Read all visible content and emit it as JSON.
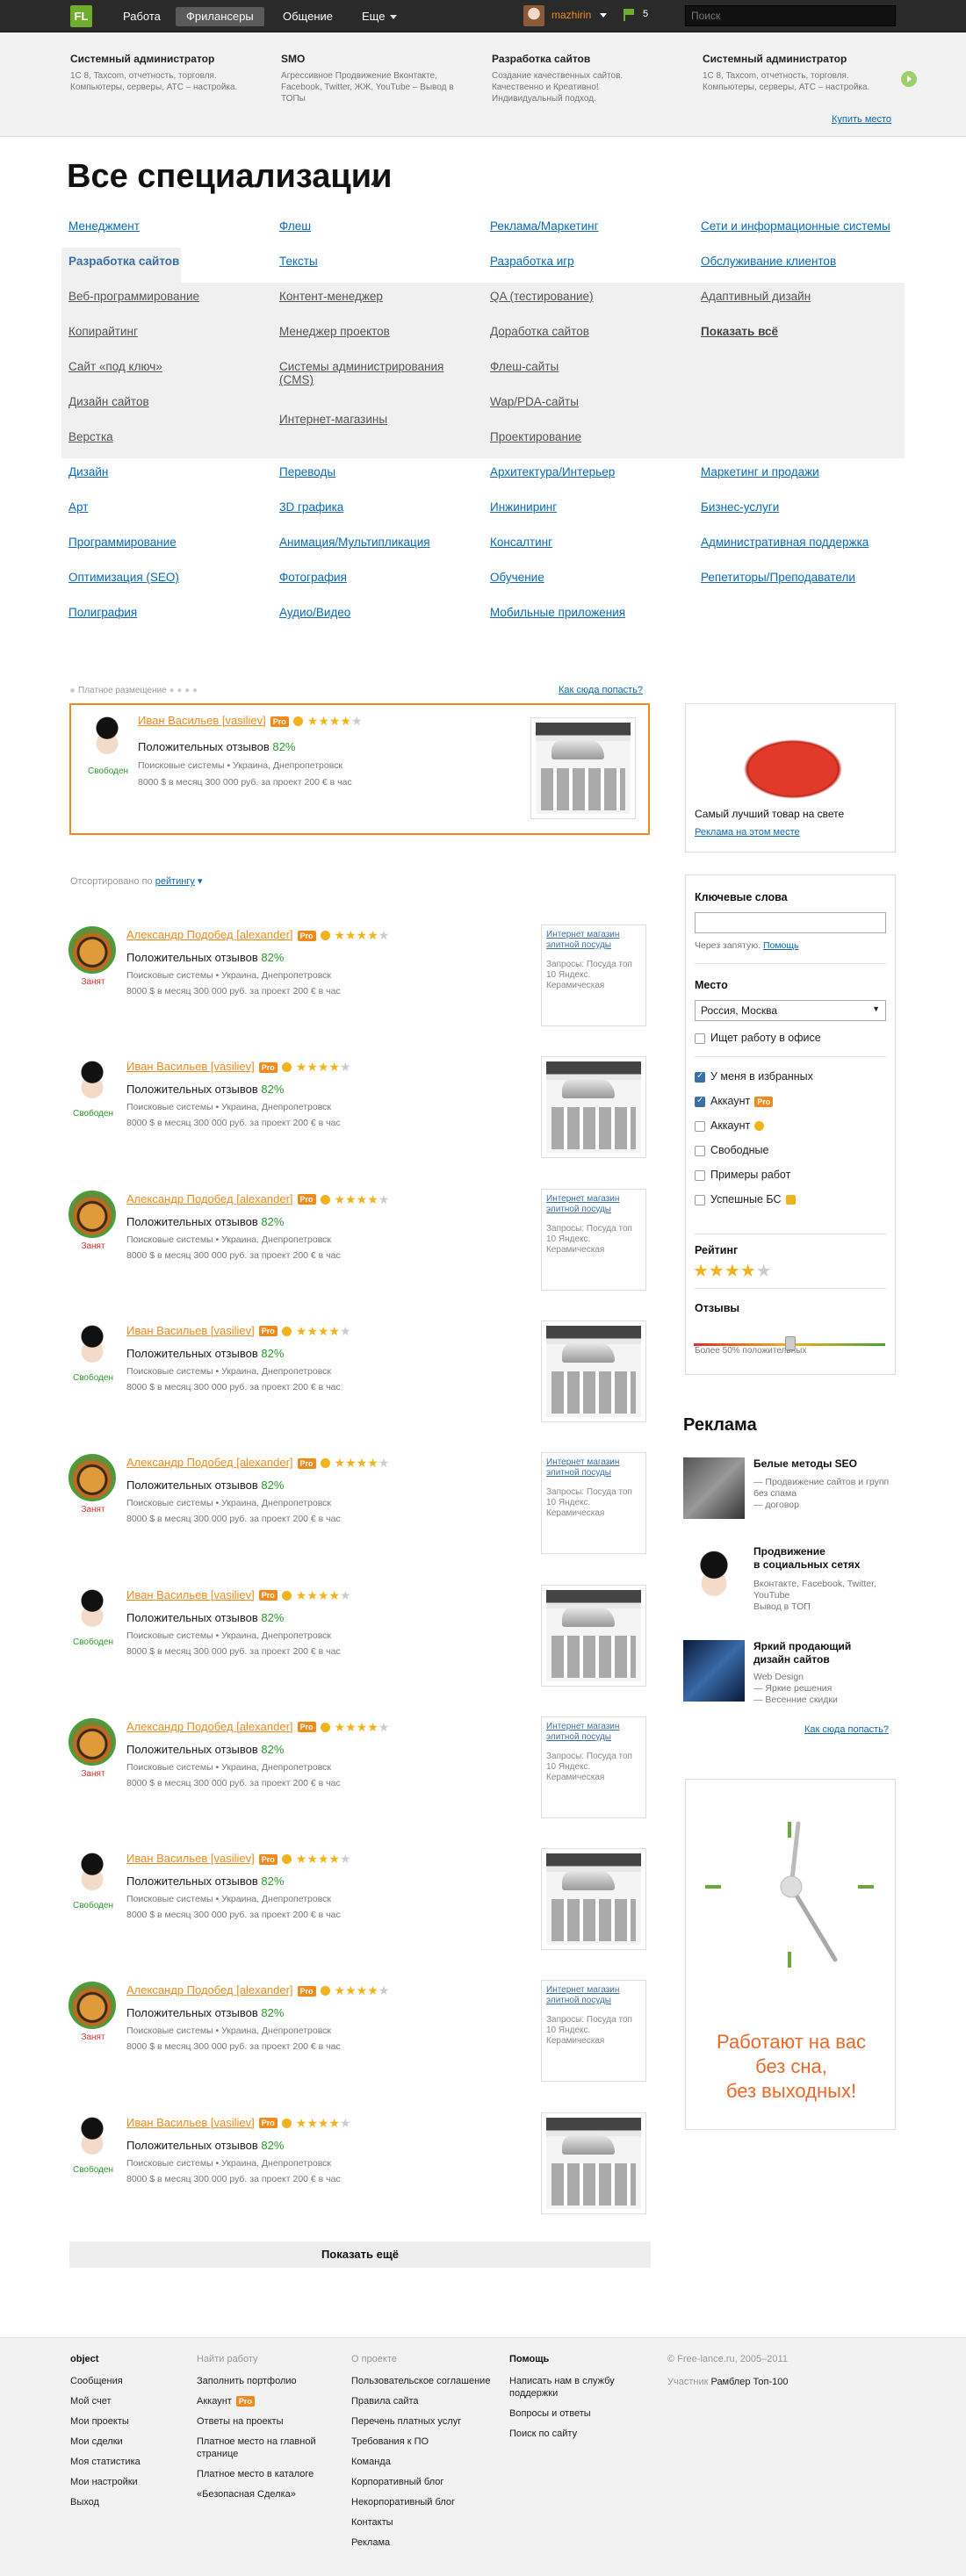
{
  "topbar": {
    "logo": "FL",
    "nav": [
      "Работа",
      "Фрилансеры",
      "Общение",
      "Еще"
    ],
    "username": "mazhirin",
    "flag_count": "5",
    "search_placeholder": "Поиск"
  },
  "strip": {
    "items": [
      {
        "title": "Системный администратор",
        "desc": "1С 8, Taxcom, отчетность, торговля. Компьютеры, серверы, АТС – настройка."
      },
      {
        "title": "SMO",
        "desc": "Агрессивное Продвижение Вконтакте, Facebook, Twitter, ЖЖ, YouTube – Вывод в ТОПы"
      },
      {
        "title": "Разработка сайтов",
        "desc": "Создание качественных сайтов. Качественно и Креативно! Индивидуальный подход."
      },
      {
        "title": "Системный администратор",
        "desc": "1С 8, Taxcom, отчетность, торговля. Компьютеры, серверы, АТС – настройка."
      }
    ],
    "buy_link": "Купить место"
  },
  "specs": {
    "title": "Все специализации",
    "col1": [
      "Менеджмент",
      "Разработка сайтов",
      "Веб-программирование",
      "Копирайтинг",
      "Сайт «под ключ»",
      "Дизайн сайтов",
      "Верстка",
      "Дизайн",
      "Арт",
      "Программирование",
      "Оптимизация (SEO)",
      "Полиграфия"
    ],
    "col2": [
      "Флеш",
      "Тексты",
      "Контент-менеджер",
      "Менеджер проектов",
      "Системы администрирования (CMS)",
      "Интернет-магазины",
      "Переводы",
      "3D графика",
      "Анимация/Мультипликация",
      "Фотография",
      "Аудио/Видео"
    ],
    "col3": [
      "Реклама/Маркетинг",
      "Разработка игр",
      "QA (тестирование)",
      "Доработка сайтов",
      "Флеш-сайты",
      "Wap/PDA-сайты",
      "Проектирование",
      "Архитектура/Интерьер",
      "Инжиниринг",
      "Консалтинг",
      "Обучение",
      "Мобильные приложения"
    ],
    "col4": [
      "Сети и информационные системы",
      "Обслуживание клиентов",
      "Адаптивный дизайн",
      "Показать всё",
      "Маркетинг и продажи",
      "Бизнес-услуги",
      "Административная поддержка",
      "Репетиторы/Преподаватели"
    ]
  },
  "paid": {
    "label": "Платное размещение",
    "how": "Как сюда попасть?",
    "freelancer": {
      "name": "Иван Васильев [vasiliev]",
      "pro": "Pro",
      "status": "Свободен",
      "reviews_label": "Положительных отзывов",
      "reviews_pct": "82%",
      "meta": "Поисковые системы  •  Украина, Днепропетровск",
      "price": "8000 $ в месяц    300 000 руб. за проект    200 € в час"
    }
  },
  "sort": {
    "prefix": "Отсортировано по",
    "link": "рейтингу"
  },
  "freelancers": [
    {
      "name": "Александр Подобед [alexander]",
      "status": "Занят",
      "type": "tiger",
      "thumb": "text"
    },
    {
      "name": "Иван Васильев [vasiliev]",
      "status": "Свободен",
      "type": "girl",
      "thumb": "shot"
    },
    {
      "name": "Александр Подобед [alexander]",
      "status": "Занят",
      "type": "tiger",
      "thumb": "text"
    },
    {
      "name": "Иван Васильев [vasiliev]",
      "status": "Свободен",
      "type": "girl",
      "thumb": "shot"
    },
    {
      "name": "Александр Подобед [alexander]",
      "status": "Занят",
      "type": "tiger",
      "thumb": "text"
    },
    {
      "name": "Иван Васильев [vasiliev]",
      "status": "Свободен",
      "type": "girl",
      "thumb": "shot"
    },
    {
      "name": "Александр Подобед [alexander]",
      "status": "Занят",
      "type": "tiger",
      "thumb": "text"
    },
    {
      "name": "Иван Васильев [vasiliev]",
      "status": "Свободен",
      "type": "girl",
      "thumb": "shot"
    },
    {
      "name": "Александр Подобед [alexander]",
      "status": "Занят",
      "type": "tiger",
      "thumb": "text"
    },
    {
      "name": "Иван Васильев [vasiliev]",
      "status": "Свободен",
      "type": "girl",
      "thumb": "shot"
    }
  ],
  "row_common": {
    "pro": "Pro",
    "reviews_label": "Положительных отзывов",
    "reviews_pct": "82%",
    "meta": "Поисковые системы  •  Украина, Днепропетровск",
    "price": "8000 $ в месяц    300 000 руб. за проект    200 € в час",
    "thumb_title": "Интернет магазин элитной посуды",
    "thumb_query": "Запросы: Посуда топ 10 Яндекс. Керамическая"
  },
  "right": {
    "promo_title": "Самый лучший товар на свете",
    "promo_link": "Реклама на этом месте",
    "keywords_title": "Ключевые слова",
    "keywords_hint": "Через запятую.",
    "keywords_help": "Помощь",
    "place_title": "Место",
    "place_value": "Россия, Москва",
    "office": "Ищет работу в офисе",
    "checks": [
      {
        "label": "У меня в избранных",
        "on": true
      },
      {
        "label": "Аккаунт",
        "on": true,
        "badge": "Pro"
      },
      {
        "label": "Аккаунт",
        "on": false,
        "badge": "ok"
      },
      {
        "label": "Свободные",
        "on": false
      },
      {
        "label": "Примеры работ",
        "on": false
      },
      {
        "label": "Успешные БС",
        "on": false
      }
    ],
    "rating_title": "Рейтинг",
    "reviews_title": "Отзывы",
    "reviews_hint": "Более 50% положительных",
    "ads_title": "Реклама",
    "ads": [
      {
        "name": "Белые методы SEO",
        "desc": "— Продвижение сайтов и групп без спама\n— договор"
      },
      {
        "name": "Продвижение\nв социальных сетях",
        "desc": "Вконтакте, Facebook, Twitter, YouTube\nВывод в ТОП"
      },
      {
        "name": "Яркий продающий\nдизайн сайтов",
        "desc": "Web Design\n— Яркие решения\n— Весенние скидки"
      }
    ],
    "ads_how": "Как сюда попасть?",
    "clock_text": "Работают на вас\nбез сна,\nбез выходных!"
  },
  "show_more": "Показать ещё",
  "footer": {
    "col1": {
      "title": "object",
      "links": [
        "Сообщения",
        "Мой счет",
        "Мои проекты",
        "Мои сделки",
        "Моя статистика",
        "Мои настройки",
        "Выход"
      ]
    },
    "col2": {
      "title": "Найти работу",
      "links": [
        "Заполнить портфолио",
        "Аккаунт",
        "Ответы на проекты",
        "Платное место на главной странице",
        "Платное место в каталоге",
        "«Безопасная Сделка»"
      ]
    },
    "col3": {
      "title": "О проекте",
      "links": [
        "Пользовательское соглашение",
        "Правила сайта",
        "Перечень платных услуг",
        "Требования к ПО",
        "Команда",
        "Корпоративный блог",
        "Некорпоративный блог",
        "Контакты",
        "Реклама"
      ]
    },
    "col4": {
      "title": "Помощь",
      "links": [
        "Написать нам в службу поддержки",
        "Вопросы и ответы",
        "Поиск по сайту"
      ]
    },
    "copyright": "© Free-lance.ru, 2005–2011",
    "member": "Участник",
    "member_link": "Рамблер Топ-100"
  }
}
